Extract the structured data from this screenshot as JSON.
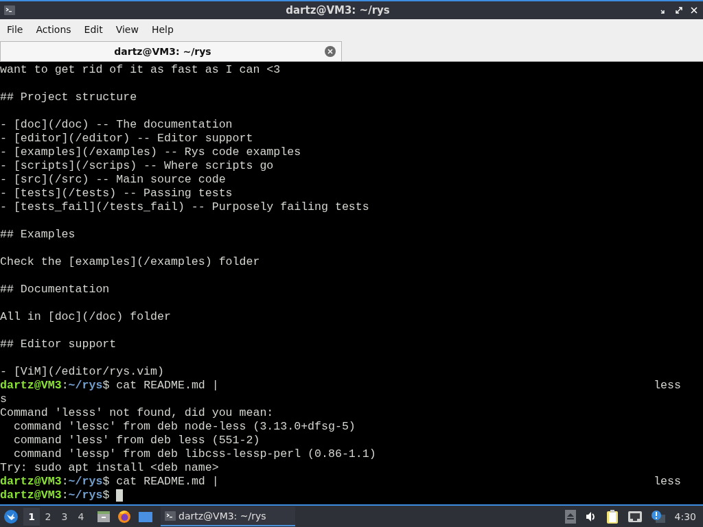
{
  "window": {
    "title": "dartz@VM3: ~/rys"
  },
  "menu": [
    "File",
    "Actions",
    "Edit",
    "View",
    "Help"
  ],
  "tabs": [
    {
      "label": "dartz@VM3: ~/rys",
      "selected": true
    }
  ],
  "terminal": {
    "lines": [
      {
        "kind": "text",
        "text": "want to get rid of it as fast as I can <3"
      },
      {
        "kind": "blank"
      },
      {
        "kind": "text",
        "text": "## Project structure"
      },
      {
        "kind": "blank"
      },
      {
        "kind": "text",
        "text": "- [doc](/doc) -- The documentation"
      },
      {
        "kind": "text",
        "text": "- [editor](/editor) -- Editor support"
      },
      {
        "kind": "text",
        "text": "- [examples](/examples) -- Rys code examples"
      },
      {
        "kind": "text",
        "text": "- [scripts](/scrips) -- Where scripts go"
      },
      {
        "kind": "text",
        "text": "- [src](/src) -- Main source code"
      },
      {
        "kind": "text",
        "text": "- [tests](/tests) -- Passing tests"
      },
      {
        "kind": "text",
        "text": "- [tests_fail](/tests_fail) -- Purposely failing tests"
      },
      {
        "kind": "blank"
      },
      {
        "kind": "text",
        "text": "## Examples"
      },
      {
        "kind": "blank"
      },
      {
        "kind": "text",
        "text": "Check the [examples](/examples) folder"
      },
      {
        "kind": "blank"
      },
      {
        "kind": "text",
        "text": "## Documentation"
      },
      {
        "kind": "blank"
      },
      {
        "kind": "text",
        "text": "All in [doc](/doc) folder"
      },
      {
        "kind": "blank"
      },
      {
        "kind": "text",
        "text": "## Editor support"
      },
      {
        "kind": "blank"
      },
      {
        "kind": "text",
        "text": "- [ViM](/editor/rys.vim)"
      },
      {
        "kind": "prompt",
        "user": "dartz@VM3",
        "colon": ":",
        "path": "~/rys",
        "sign": "$",
        "command": "cat README.md |",
        "wrapped": "less"
      },
      {
        "kind": "text",
        "text": "s"
      },
      {
        "kind": "text",
        "text": "Command 'lesss' not found, did you mean:"
      },
      {
        "kind": "text",
        "text": "  command 'lessc' from deb node-less (3.13.0+dfsg-5)"
      },
      {
        "kind": "text",
        "text": "  command 'less' from deb less (551-2)"
      },
      {
        "kind": "text",
        "text": "  command 'lessp' from deb libcss-lessp-perl (0.86-1.1)"
      },
      {
        "kind": "text",
        "text": "Try: sudo apt install <deb name>"
      },
      {
        "kind": "prompt",
        "user": "dartz@VM3",
        "colon": ":",
        "path": "~/rys",
        "sign": "$",
        "command": "cat README.md |",
        "wrapped": "less"
      },
      {
        "kind": "prompt",
        "user": "dartz@VM3",
        "colon": ":",
        "path": "~/rys",
        "sign": "$",
        "cursor": true
      }
    ]
  },
  "taskbar": {
    "desktops": [
      {
        "label": "1",
        "selected": true
      },
      {
        "label": "2",
        "selected": false
      },
      {
        "label": "3",
        "selected": false
      },
      {
        "label": "4",
        "selected": false
      }
    ],
    "tasks": [
      {
        "label": "dartz@VM3: ~/rys",
        "selected": true
      }
    ],
    "clock": "4:30"
  }
}
